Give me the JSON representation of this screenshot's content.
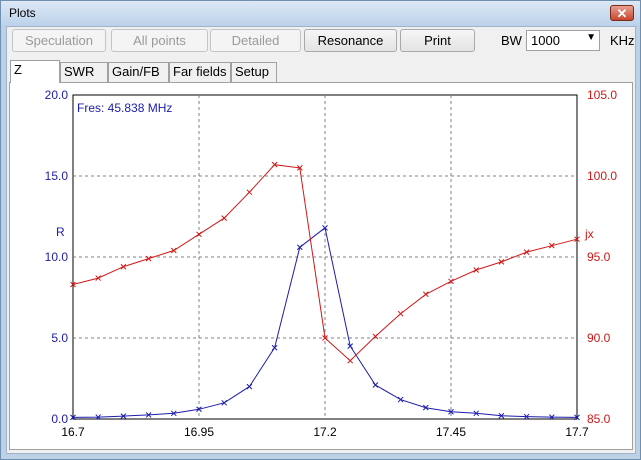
{
  "window": {
    "title": "Plots",
    "close_label": "✕"
  },
  "toolbar": {
    "buttons": [
      {
        "label": "Speculation",
        "enabled": false
      },
      {
        "label": "All points",
        "enabled": false
      },
      {
        "label": "Detailed",
        "enabled": false
      },
      {
        "label": "Resonance",
        "enabled": true
      },
      {
        "label": "Print",
        "enabled": true
      }
    ],
    "bw_label": "BW",
    "bw_value": "1000",
    "bw_unit": "KHz"
  },
  "tabs": [
    "Z",
    "SWR",
    "Gain/FB",
    "Far fields",
    "Setup"
  ],
  "active_tab": "Z",
  "colors": {
    "r_series": "#1c1cac",
    "jx_series": "#d01818",
    "grid": "#808080"
  },
  "chart_data": {
    "type": "line",
    "annotation": "Fres: 45.838 MHz",
    "xlim": [
      16.7,
      17.7
    ],
    "x_ticks": [
      "16.7",
      "16.95",
      "17.2",
      "17.45",
      "17.7"
    ],
    "y_left": {
      "label": "R",
      "lim": [
        0,
        20
      ],
      "ticks": [
        "0.0",
        "5.0",
        "10.0",
        "15.0",
        "20.0"
      ]
    },
    "y_right": {
      "label": "jx",
      "lim": [
        85,
        105
      ],
      "ticks": [
        "85.0",
        "90.0",
        "95.0",
        "100.0",
        "105.0"
      ]
    },
    "grid": true,
    "series": [
      {
        "name": "R",
        "axis": "left",
        "x": [
          16.7,
          16.75,
          16.8,
          16.85,
          16.9,
          16.95,
          17.0,
          17.05,
          17.1,
          17.15,
          17.2,
          17.25,
          17.3,
          17.35,
          17.4,
          17.45,
          17.5,
          17.55,
          17.6,
          17.65,
          17.7
        ],
        "values": [
          0.1,
          0.12,
          0.18,
          0.25,
          0.35,
          0.6,
          1.0,
          2.0,
          4.4,
          10.6,
          11.8,
          4.5,
          2.1,
          1.2,
          0.7,
          0.45,
          0.35,
          0.2,
          0.15,
          0.12,
          0.1
        ]
      },
      {
        "name": "jx",
        "axis": "right",
        "x": [
          16.7,
          16.75,
          16.8,
          16.85,
          16.9,
          16.95,
          17.0,
          17.05,
          17.1,
          17.15,
          17.2,
          17.25,
          17.3,
          17.35,
          17.4,
          17.45,
          17.5,
          17.55,
          17.6,
          17.65,
          17.7
        ],
        "values": [
          93.3,
          93.7,
          94.4,
          94.9,
          95.4,
          96.4,
          97.4,
          99.0,
          100.7,
          100.5,
          90.0,
          88.6,
          90.1,
          91.5,
          92.7,
          93.5,
          94.2,
          94.7,
          95.3,
          95.7,
          96.1
        ]
      }
    ]
  }
}
